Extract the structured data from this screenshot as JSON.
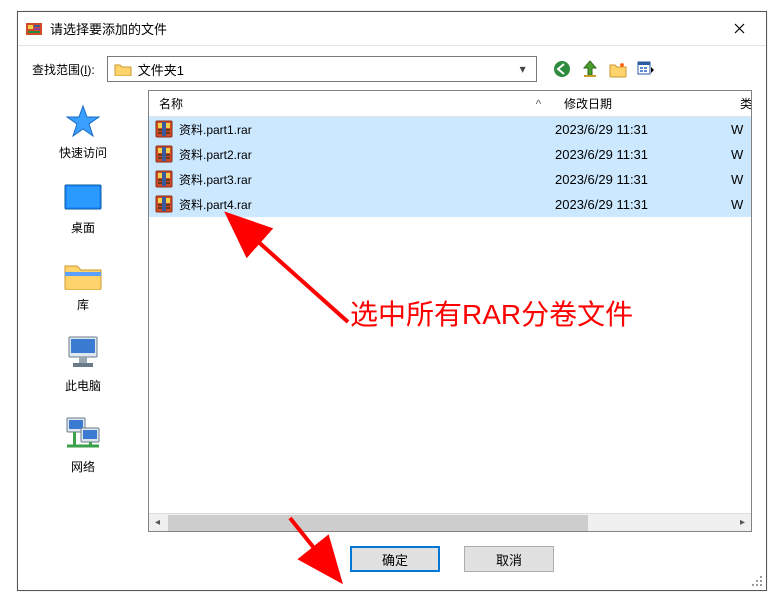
{
  "window": {
    "title": "请选择要添加的文件",
    "close_tooltip": "关闭"
  },
  "nav": {
    "label_prefix": "查找范围(",
    "label_hotkey": "I",
    "label_suffix": "):",
    "combo_value": "文件夹1"
  },
  "sidebar": {
    "items": [
      {
        "id": "quick",
        "label": "快速访问"
      },
      {
        "id": "desktop",
        "label": "桌面"
      },
      {
        "id": "library",
        "label": "库"
      },
      {
        "id": "thispc",
        "label": "此电脑"
      },
      {
        "id": "network",
        "label": "网络"
      }
    ]
  },
  "columns": {
    "name": "名称",
    "sort_caret": "^",
    "date": "修改日期",
    "type_trunc": "类"
  },
  "files": [
    {
      "name": "资料.part1.rar",
      "date": "2023/6/29 11:31",
      "type_trunc": "W"
    },
    {
      "name": "资料.part2.rar",
      "date": "2023/6/29 11:31",
      "type_trunc": "W"
    },
    {
      "name": "资料.part3.rar",
      "date": "2023/6/29 11:31",
      "type_trunc": "W"
    },
    {
      "name": "资料.part4.rar",
      "date": "2023/6/29 11:31",
      "type_trunc": "W"
    }
  ],
  "buttons": {
    "ok": "确定",
    "cancel": "取消"
  },
  "annotation": {
    "text": "选中所有RAR分卷文件"
  }
}
